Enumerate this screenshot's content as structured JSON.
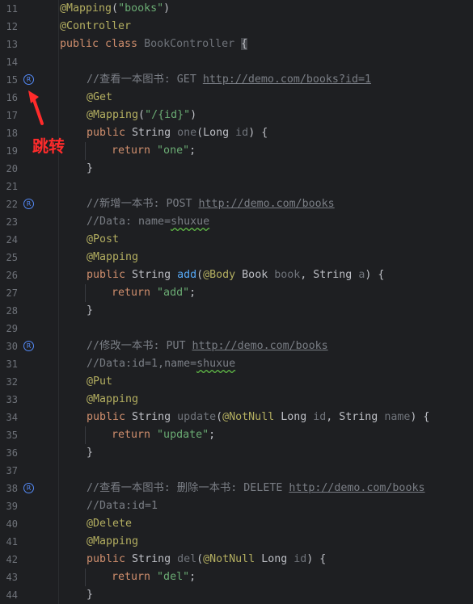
{
  "jump_label": "跳转",
  "line_numbers": [
    "11",
    "12",
    "13",
    "14",
    "15",
    "16",
    "17",
    "18",
    "19",
    "20",
    "21",
    "22",
    "23",
    "24",
    "25",
    "26",
    "27",
    "28",
    "29",
    "30",
    "31",
    "32",
    "33",
    "34",
    "35",
    "36",
    "37",
    "38",
    "39",
    "40",
    "41",
    "42",
    "43",
    "44"
  ],
  "gutter_marks": {
    "lines": [
      "15",
      "22",
      "30",
      "38"
    ],
    "glyph": "R"
  },
  "code": {
    "l11": {
      "ann": "@Mapping",
      "p1": "(",
      "str": "\"books\"",
      "p2": ")"
    },
    "l12": {
      "ann": "@Controller"
    },
    "l13": {
      "kw": "public class",
      "name": " BookController ",
      "brace": "{"
    },
    "l15": {
      "cmt": "//查看一本图书: GET ",
      "link": "http://demo.com/books?id=1"
    },
    "l16": {
      "ann": "@Get"
    },
    "l17": {
      "ann": "@Mapping",
      "p1": "(",
      "str": "\"/{id}\"",
      "p2": ")"
    },
    "l18": {
      "kw": "public",
      "t1": " String ",
      "fn": "one",
      "t2": "(Long ",
      "p": "id",
      "t3": ") {"
    },
    "l19": {
      "kw": "return",
      "str": " \"one\"",
      "end": ";"
    },
    "l20": {
      "t": "}"
    },
    "l22": {
      "cmt": "//新增一本书: POST ",
      "link": "http://demo.com/books"
    },
    "l23": {
      "cmt": "//Data: name=",
      "typo": "shuxue"
    },
    "l24": {
      "ann": "@Post"
    },
    "l25": {
      "ann": "@Mapping"
    },
    "l26": {
      "kw": "public",
      "t1": " String ",
      "fn": "add",
      "t2": "(",
      "ann": "@Body",
      "t3": " Book ",
      "p1": "book",
      "t4": ", String ",
      "p2": "a",
      "t5": ") {"
    },
    "l27": {
      "kw": "return",
      "str": " \"add\"",
      "end": ";"
    },
    "l28": {
      "t": "}"
    },
    "l30": {
      "cmt": "//修改一本书: PUT ",
      "link": "http://demo.com/books"
    },
    "l31": {
      "cmt": "//Data:id=1,name=",
      "typo": "shuxue"
    },
    "l32": {
      "ann": "@Put"
    },
    "l33": {
      "ann": "@Mapping"
    },
    "l34": {
      "kw": "public",
      "t1": " String ",
      "fn": "update",
      "t2": "(",
      "ann": "@NotNull",
      "t3": " Long ",
      "p1": "id",
      "t4": ", String ",
      "p2": "name",
      "t5": ") {"
    },
    "l35": {
      "kw": "return",
      "str": " \"update\"",
      "end": ";"
    },
    "l36": {
      "t": "}"
    },
    "l38": {
      "cmt": "//查看一本图书: 删除一本书: DELETE ",
      "link": "http://demo.com/books"
    },
    "l39": {
      "cmt": "//Data:id=1"
    },
    "l40": {
      "ann": "@Delete"
    },
    "l41": {
      "ann": "@Mapping"
    },
    "l42": {
      "kw": "public",
      "t1": " String ",
      "fn": "del",
      "t2": "(",
      "ann": "@NotNull",
      "t3": " Long ",
      "p1": "id",
      "t4": ") {"
    },
    "l43": {
      "kw": "return",
      "str": " \"del\"",
      "end": ";"
    },
    "l44": {
      "t": "}"
    }
  },
  "colors": {
    "background": "#1e1f22",
    "keyword": "#cf8e6d",
    "annotation": "#b3ae60",
    "string": "#6aab73",
    "comment": "#7a7e85",
    "function": "#56a8f5",
    "marker": "#548af7",
    "arrow": "#ff2b2b"
  }
}
